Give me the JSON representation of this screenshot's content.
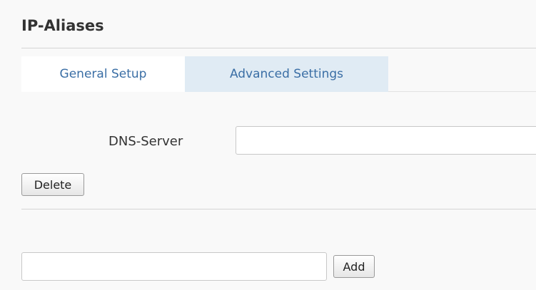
{
  "section": {
    "title": "IP-Aliases"
  },
  "tabs": [
    {
      "label": "General Setup",
      "active": false
    },
    {
      "label": "Advanced Settings",
      "active": true
    }
  ],
  "dns_field": {
    "label": "DNS-Server",
    "value": ""
  },
  "buttons": {
    "delete_label": "Delete",
    "add_label": "Add"
  },
  "add_field": {
    "value": ""
  },
  "colors": {
    "tab_text": "#3a6ea5",
    "active_tab_bg": "#e0ebf4",
    "page_bg": "#f9f9f9"
  }
}
